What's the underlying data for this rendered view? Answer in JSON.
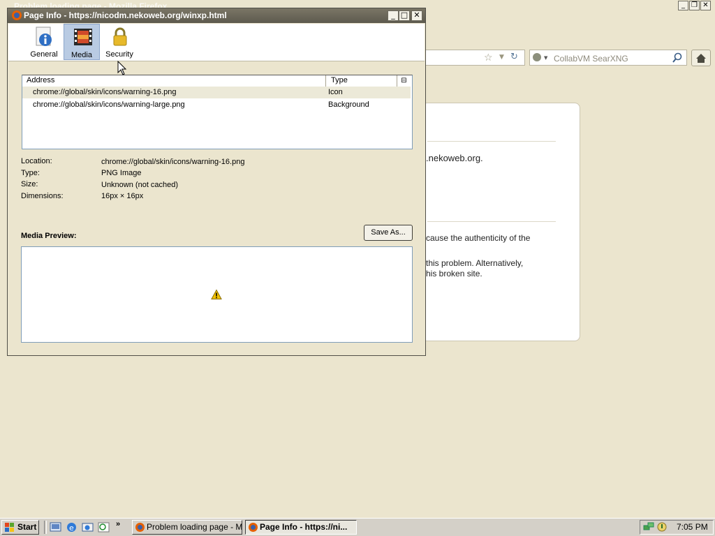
{
  "background_window": {
    "title": "Problem loading page - Mozilla Firefox",
    "search_placeholder": "CollabVM SearXNG",
    "content_lines": [
      ".nekoweb.org.",
      "cause the authenticity of the",
      "this problem. Alternatively,",
      "his broken site."
    ]
  },
  "dialog": {
    "title": "Page Info - https://nicodm.nekoweb.org/winxp.html",
    "tabs": [
      {
        "label": "General",
        "icon": "info-icon"
      },
      {
        "label": "Media",
        "icon": "film-icon",
        "selected": true
      },
      {
        "label": "Security",
        "icon": "padlock-icon"
      }
    ],
    "media_list": {
      "columns": [
        "Address",
        "Type"
      ],
      "rows": [
        {
          "address": "chrome://global/skin/icons/warning-16.png",
          "type": "Icon",
          "selected": true
        },
        {
          "address": "chrome://global/skin/icons/warning-large.png",
          "type": "Background",
          "selected": false
        }
      ]
    },
    "properties": [
      {
        "label": "Location:",
        "value": "chrome://global/skin/icons/warning-16.png"
      },
      {
        "label": "Type:",
        "value": "PNG Image"
      },
      {
        "label": "Size:",
        "value": "Unknown (not cached)"
      },
      {
        "label": "Dimensions:",
        "value": "16px × 16px"
      }
    ],
    "preview_label": "Media Preview:",
    "save_as_label": "Save As..."
  },
  "taskbar": {
    "start_label": "Start",
    "buttons": [
      {
        "label": "Problem loading page - Mo...",
        "active": false
      },
      {
        "label": "Page Info - https://ni...",
        "active": true
      }
    ],
    "clock": "7:05 PM"
  },
  "colors": {
    "desktop_bg": "#ebe5ce",
    "selected_tab": "#b9cbe3",
    "warning": "#f2c200"
  }
}
